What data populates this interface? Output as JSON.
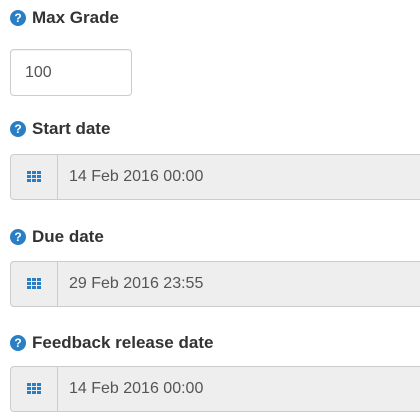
{
  "fields": {
    "max_grade": {
      "label": "Max Grade",
      "value": "100",
      "help_icon": "question-circle-icon"
    },
    "start_date": {
      "label": "Start date",
      "value": "14 Feb 2016 00:00",
      "help_icon": "question-circle-icon",
      "picker_icon": "calendar-grid-icon"
    },
    "due_date": {
      "label": "Due date",
      "value": "29 Feb 2016 23:55",
      "help_icon": "question-circle-icon",
      "picker_icon": "calendar-grid-icon"
    },
    "feedback_release_date": {
      "label": "Feedback release date",
      "value": "14 Feb 2016 00:00",
      "help_icon": "question-circle-icon",
      "picker_icon": "calendar-grid-icon"
    }
  },
  "help_glyph": "?",
  "colors": {
    "accent": "#2a7fc4",
    "label_text": "#333333",
    "input_text": "#555555",
    "addon_background": "#eeeeee",
    "border": "#cccccc"
  }
}
